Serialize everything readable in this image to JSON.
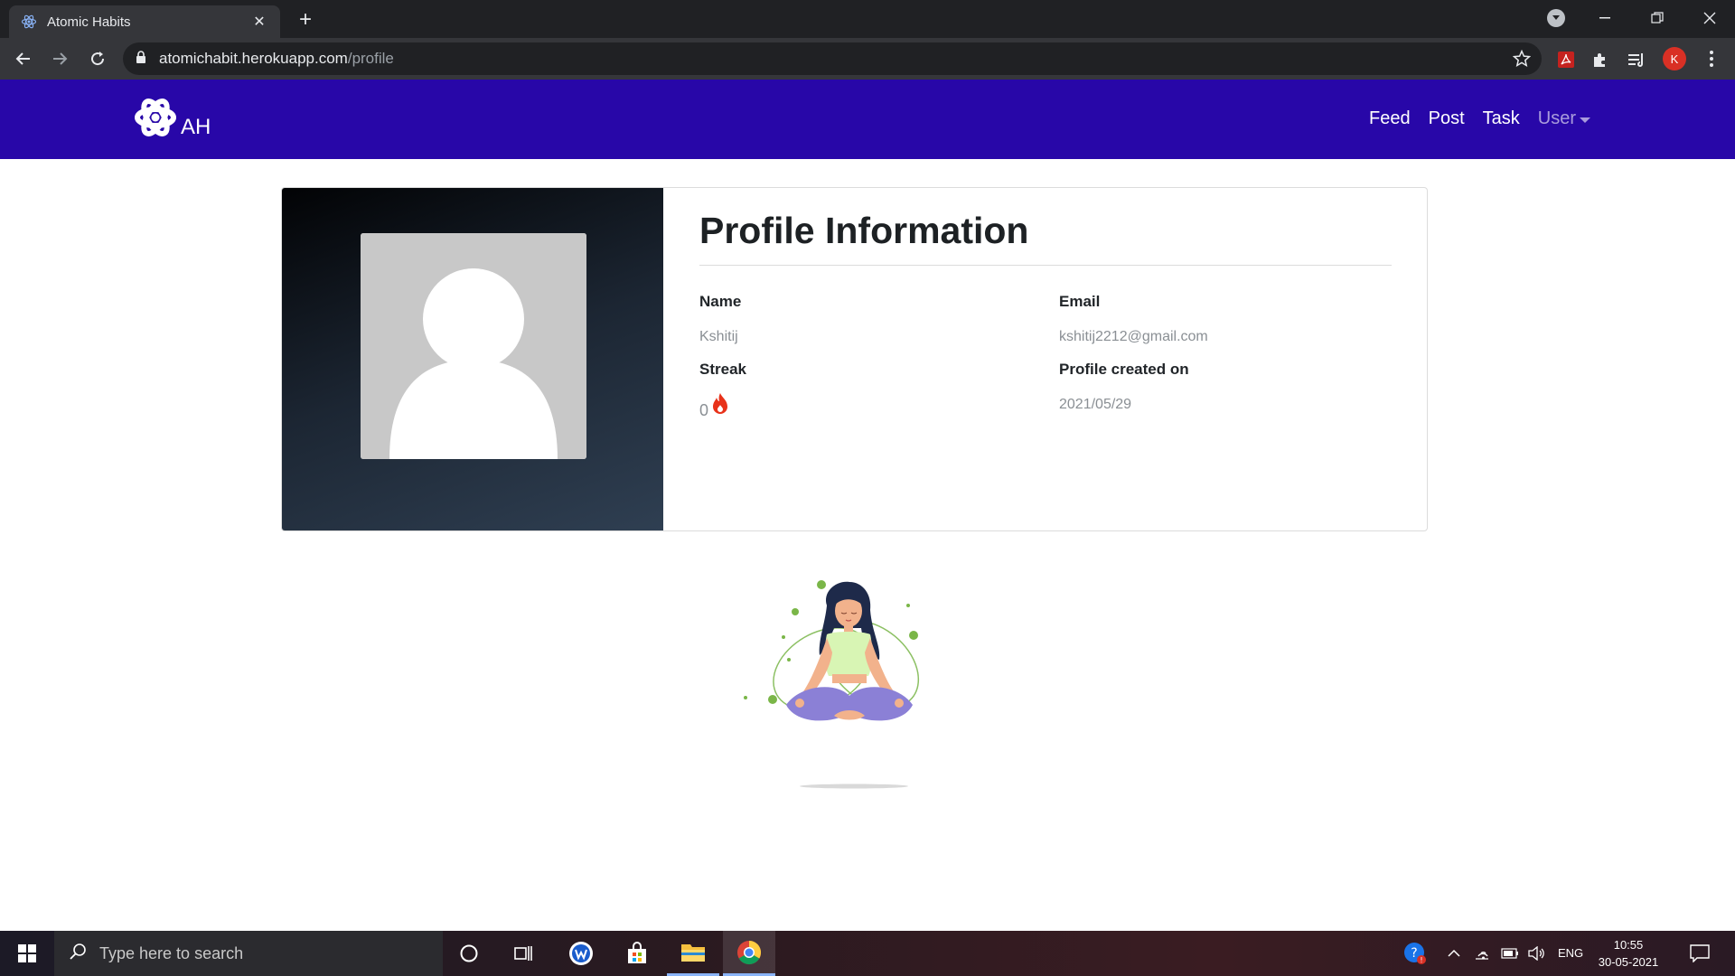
{
  "browser": {
    "tab_title": "Atomic Habits",
    "url_host": "atomichabit.herokuapp.com",
    "url_path": "/profile",
    "avatar_letter": "K"
  },
  "navbar": {
    "brand": "AH",
    "links": [
      "Feed",
      "Post",
      "Task",
      "User"
    ]
  },
  "profile": {
    "title": "Profile Information",
    "fields": {
      "name_label": "Name",
      "name_value": "Kshitij",
      "email_label": "Email",
      "email_value": "kshitij2212@gmail.com",
      "streak_label": "Streak",
      "streak_value": "0",
      "created_label": "Profile created on",
      "created_value": "2021/05/29"
    }
  },
  "taskbar": {
    "search_placeholder": "Type here to search",
    "language": "ENG",
    "time": "10:55",
    "date": "30-05-2021"
  },
  "colors": {
    "navbar_bg": "#2807a8",
    "browser_dark": "#202124",
    "streak_flame": "#e8321a"
  }
}
